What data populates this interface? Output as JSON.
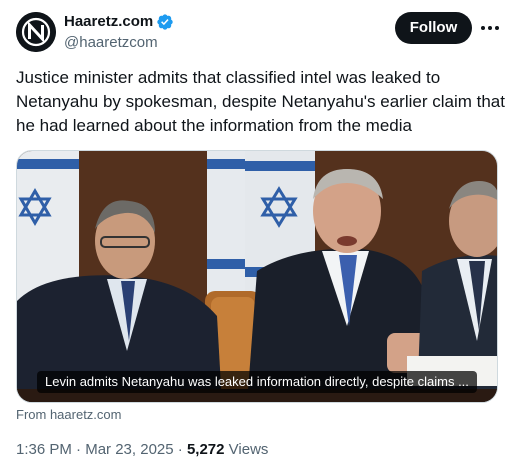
{
  "author": {
    "display_name": "Haaretz.com",
    "handle": "@haaretzcom",
    "verified_icon": "verified-badge-icon",
    "verified_color": "#1d9bf0"
  },
  "actions": {
    "follow_label": "Follow",
    "more_icon": "more-horizontal-icon"
  },
  "tweet": {
    "text": "Justice minister admits that classified intel was leaked to Netanyahu by spokesman, despite Netanyahu's earlier claim that he had learned about the information from the media"
  },
  "card": {
    "caption": "Levin admits Netanyahu was leaked information directly, despite claims ...",
    "source": "From haaretz.com"
  },
  "meta": {
    "time": "1:36 PM",
    "separator": "·",
    "date": "Mar 23, 2025",
    "views_count": "5,272",
    "views_label": "Views"
  },
  "colors": {
    "text_primary": "#0f1419",
    "text_secondary": "#536471",
    "button_bg": "#0f1419"
  }
}
